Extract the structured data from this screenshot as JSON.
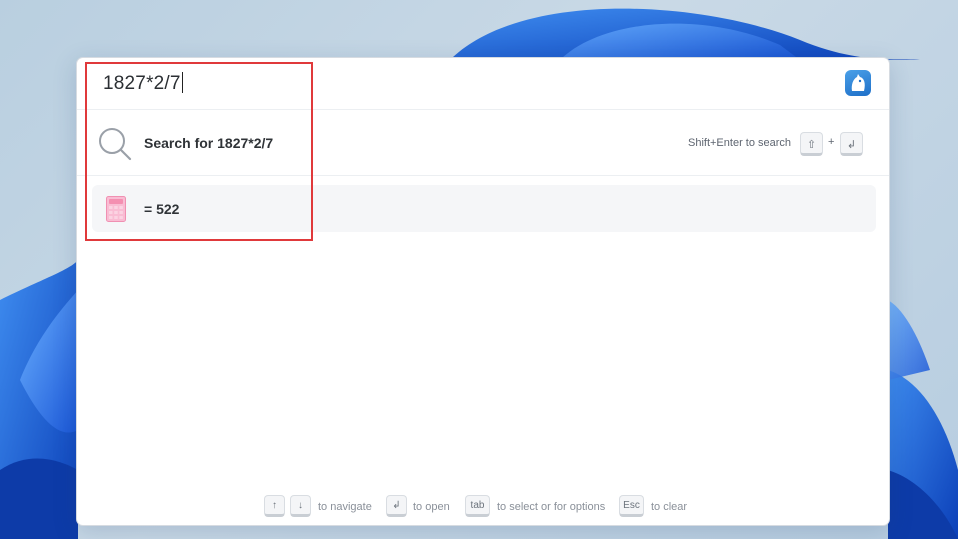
{
  "search": {
    "query": "1827*2/7",
    "search_for_label": "Search for 1827*2/7",
    "shortcut_hint": "Shift+Enter to search",
    "shift_key": "⇧",
    "plus": "+",
    "enter_key": "↲"
  },
  "result": {
    "value_label": "= 522"
  },
  "footer": {
    "up_key": "↑",
    "down_key": "↓",
    "navigate_label": "to navigate",
    "enter_key": "↲",
    "open_label": "to open",
    "tab_key": "tab",
    "tab_label": "to select or for options",
    "esc_key": "Esc",
    "esc_label": "to clear"
  },
  "colors": {
    "highlight_box": "#e0393b",
    "logo_blue": "#1e6fc8",
    "calculator_pink": "#f48fb1"
  },
  "icons": {
    "search": "magnifier-icon",
    "app": "app-logo-icon",
    "result": "calculator-icon"
  }
}
